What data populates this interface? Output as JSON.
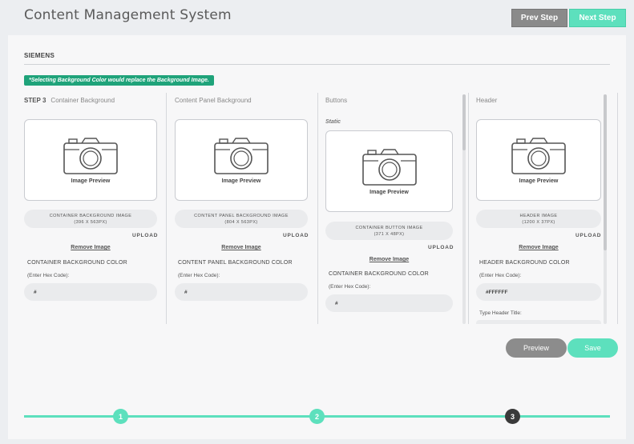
{
  "header": {
    "title": "Content Management System",
    "prev_step": "Prev Step",
    "next_step": "Next Step"
  },
  "org": {
    "name": "SIEMENS"
  },
  "notice": "*Selecting Background Color would replace the Background Image.",
  "step_label": "STEP 3",
  "columns": [
    {
      "header": "Container Background",
      "static_label": "",
      "preview_text": "Image Preview",
      "image_label": "CONTAINER BACKGROUND IMAGE",
      "image_size": "(396 X 563PX)",
      "upload": "UPLOAD",
      "remove": "Remove Image",
      "color_title": "CONTAINER BACKGROUND COLOR",
      "hex_hint": "(Enter Hex Code):",
      "hex_value": "#"
    },
    {
      "header": "Content Panel Background",
      "static_label": "",
      "preview_text": "Image Preview",
      "image_label": "CONTENT PANEL BACKGROUND IMAGE",
      "image_size": "(804 X 563PX)",
      "upload": "UPLOAD",
      "remove": "Remove Image",
      "color_title": "CONTENT PANEL BACKGROUND COLOR",
      "hex_hint": "(Enter Hex Code):",
      "hex_value": "#"
    },
    {
      "header": "Buttons",
      "static_label": "Static",
      "preview_text": "Image Preview",
      "image_label": "CONTAINER BUTTON IMAGE",
      "image_size": "(371 X 48PX)",
      "upload": "UPLOAD",
      "remove": "Remove Image",
      "color_title": "CONTAINER BACKGROUND COLOR",
      "hex_hint": "(Enter Hex Code):",
      "hex_value": "#"
    },
    {
      "header": "Header",
      "static_label": "",
      "preview_text": "Image Preview",
      "image_label": "HEADER IMAGE",
      "image_size": "(1200 X 37PX)",
      "upload": "UPLOAD",
      "remove": "Remove Image",
      "color_title": "HEADER BACKGROUND COLOR",
      "hex_hint": "(Enter Hex Code):",
      "hex_value": "#FFFFFF",
      "title_hint": "Type Header Title:"
    }
  ],
  "actions": {
    "preview": "Preview",
    "save": "Save"
  },
  "progress": {
    "steps": [
      "1",
      "2",
      "3"
    ],
    "current_step": 3
  },
  "colors": {
    "accent": "#5de0bd",
    "notice_bg": "#1fa37a",
    "muted_button": "#8c8c8c",
    "current_step": "#3a3a3a"
  },
  "icons": {
    "preview": "camera-icon"
  }
}
